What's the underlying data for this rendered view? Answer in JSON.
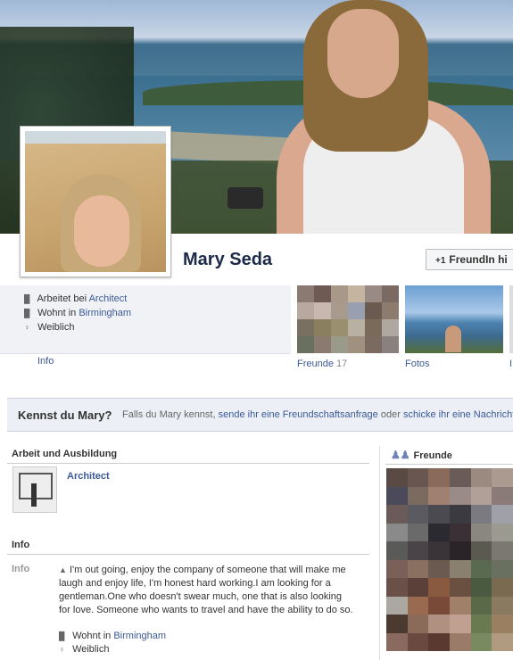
{
  "profile": {
    "name": "Mary Seda",
    "add_friend_label": "FreundIn hi"
  },
  "intro": {
    "work_prefix": "Arbeitet bei",
    "work_link": "Architect",
    "lives_prefix": "Wohnt in",
    "lives_link": "Birmingham",
    "gender": "Weiblich",
    "info_tab": "Info"
  },
  "thumbs": {
    "friends_label": "Freunde",
    "friends_count": "17",
    "photos_label": "Fotos",
    "third_label": "I"
  },
  "know": {
    "question": "Kennst du Mary?",
    "text1": "Falls du Mary kennst,",
    "link1": "sende ihr eine Freundschaftsanfrage",
    "text2": "oder",
    "link2": "schicke ihr eine Nachricht",
    "text3": "."
  },
  "work_section": {
    "title": "Arbeit und Ausbildung",
    "employer": "Architect"
  },
  "info_section": {
    "title": "Info",
    "label": "Info",
    "bio": "I'm out going, enjoy the company of someone that will make me laugh and enjoy life, I'm honest hard working.I am looking for a gentleman.One who doesn't swear much, one that is also looking for love. Someone who wants to travel and have the ability to do so.",
    "lives_prefix": "Wohnt in",
    "lives_link": "Birmingham",
    "gender": "Weiblich"
  },
  "friends_box": {
    "title": "Freunde"
  },
  "colors": {
    "link": "#3b5998",
    "intro_bg": "#f0f2f6",
    "know_bg": "#eceff5"
  },
  "icons": [
    "briefcase-icon",
    "home-icon",
    "gender-icon",
    "add-friend-icon",
    "friends-icon",
    "person-icon"
  ]
}
